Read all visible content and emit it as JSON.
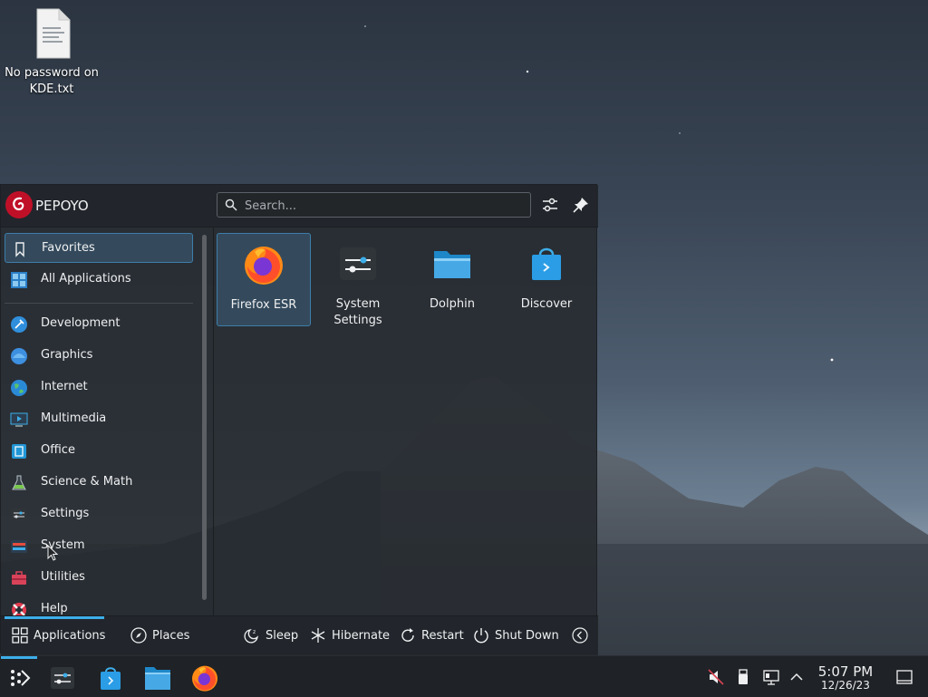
{
  "desktop": {
    "file_icon_label": "No password on KDE.txt"
  },
  "launcher": {
    "username": "PEPOYO",
    "search_placeholder": "Search...",
    "categories": [
      {
        "label": "Favorites",
        "icon": "bookmark-icon"
      },
      {
        "label": "All Applications",
        "icon": "grid-icon"
      },
      {
        "label": "Development",
        "icon": "development-icon"
      },
      {
        "label": "Graphics",
        "icon": "graphics-icon"
      },
      {
        "label": "Internet",
        "icon": "globe-icon"
      },
      {
        "label": "Multimedia",
        "icon": "multimedia-icon"
      },
      {
        "label": "Office",
        "icon": "office-icon"
      },
      {
        "label": "Science & Math",
        "icon": "flask-icon"
      },
      {
        "label": "Settings",
        "icon": "settings-icon"
      },
      {
        "label": "System",
        "icon": "system-icon"
      },
      {
        "label": "Utilities",
        "icon": "toolbox-icon"
      },
      {
        "label": "Help",
        "icon": "lifebuoy-icon"
      }
    ],
    "apps": [
      {
        "label": "Firefox ESR",
        "icon": "firefox-icon"
      },
      {
        "label": "System Settings",
        "icon": "system-settings-icon"
      },
      {
        "label": "Dolphin",
        "icon": "folder-icon"
      },
      {
        "label": "Discover",
        "icon": "discover-icon"
      }
    ],
    "footer": {
      "tab_applications": "Applications",
      "tab_places": "Places",
      "sleep": "Sleep",
      "hibernate": "Hibernate",
      "restart": "Restart",
      "shutdown": "Shut Down"
    }
  },
  "taskbar": {
    "clock_time": "5:07 PM",
    "clock_date": "12/26/23"
  },
  "colors": {
    "accent": "#3daee9",
    "panel": "#282c32",
    "avatar": "#c01028"
  }
}
